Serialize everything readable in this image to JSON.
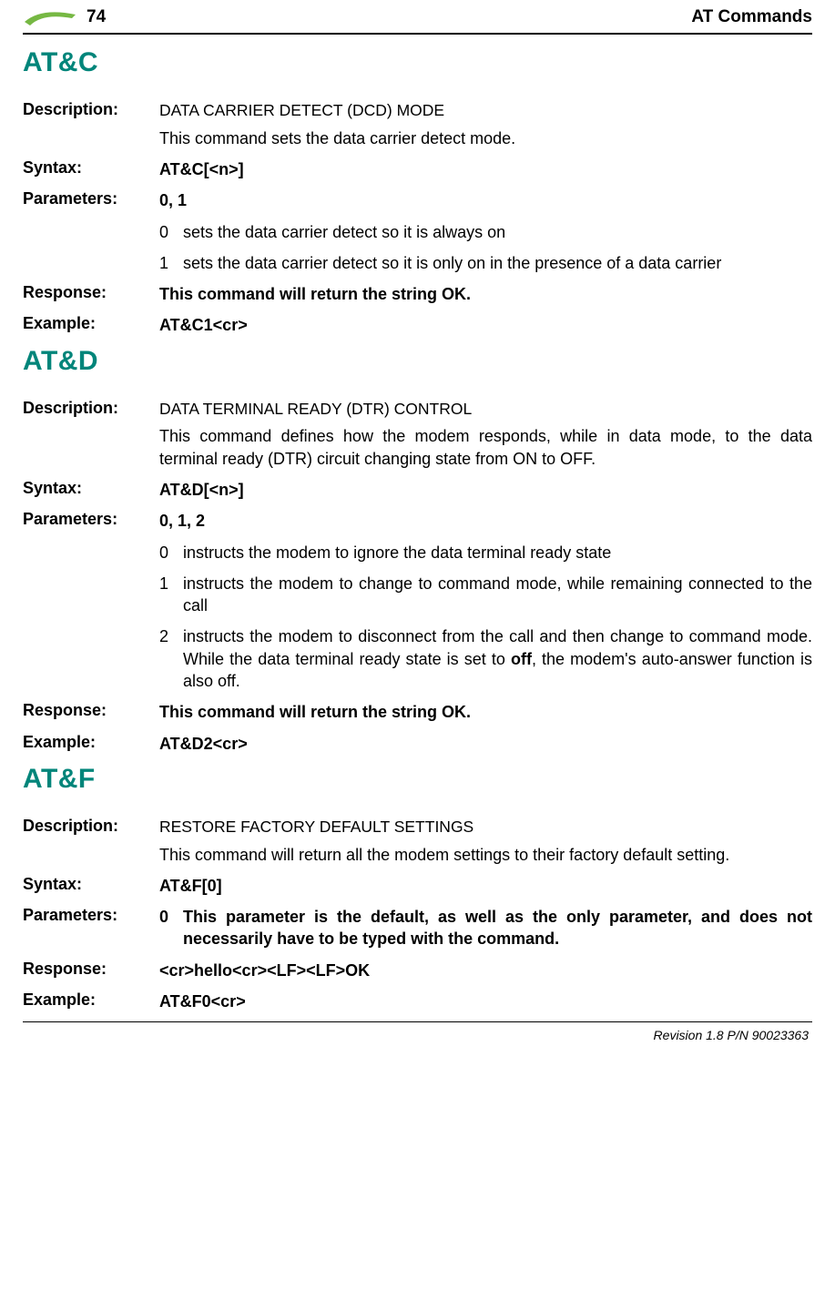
{
  "header": {
    "page_number": "74",
    "title": "AT Commands"
  },
  "sections": [
    {
      "title": "AT&C",
      "description_caps": "DATA CARRIER DETECT (DCD) MODE",
      "description_body": "This command sets the data carrier detect mode.",
      "syntax": "AT&C[<n>]",
      "parameters_header": "0, 1",
      "parameters": [
        {
          "key": "0",
          "text": "sets the data carrier detect so it is always on"
        },
        {
          "key": "1",
          "text": "sets the data carrier detect so it is only on in the presence of a data carrier"
        }
      ],
      "response": "This command will return the string OK.",
      "example": "AT&C1<cr>"
    },
    {
      "title": "AT&D",
      "description_caps": "DATA TERMINAL READY (DTR) CONTROL",
      "description_body": "This command defines how the modem responds, while in data mode, to the data terminal ready (DTR) circuit changing state from ON to OFF.",
      "syntax": "AT&D[<n>]",
      "parameters_header": "0, 1, 2",
      "parameters": [
        {
          "key": "0",
          "text": "instructs the modem to ignore the data terminal ready state"
        },
        {
          "key": "1",
          "text": "instructs the modem to change to command mode, while remaining connected to the call"
        }
      ],
      "param2_key": "2",
      "param2_prefix": "instructs the modem to disconnect from the call and then change to command mode. While the data terminal ready state is set to ",
      "param2_bold": "off",
      "param2_suffix": ", the modem's auto-answer function is also off.",
      "response": "This command will return the string OK.",
      "example": "AT&D2<cr>"
    },
    {
      "title": "AT&F",
      "description_caps": "RESTORE FACTORY DEFAULT SETTINGS",
      "description_body": "This command will return all the modem settings to their factory default setting.",
      "syntax": "AT&F[0]",
      "param0_key": "0",
      "param0_text": "This parameter is the default, as well as the only parameter, and does not necessarily have to be typed with the command.",
      "response": "<cr>hello<cr><LF><LF>OK",
      "example": "AT&F0<cr>"
    }
  ],
  "labels": {
    "description": "Description:",
    "syntax": "Syntax:",
    "parameters": "Parameters:",
    "response": "Response:",
    "example": "Example:"
  },
  "footer": "Revision 1.8  P/N 90023363"
}
